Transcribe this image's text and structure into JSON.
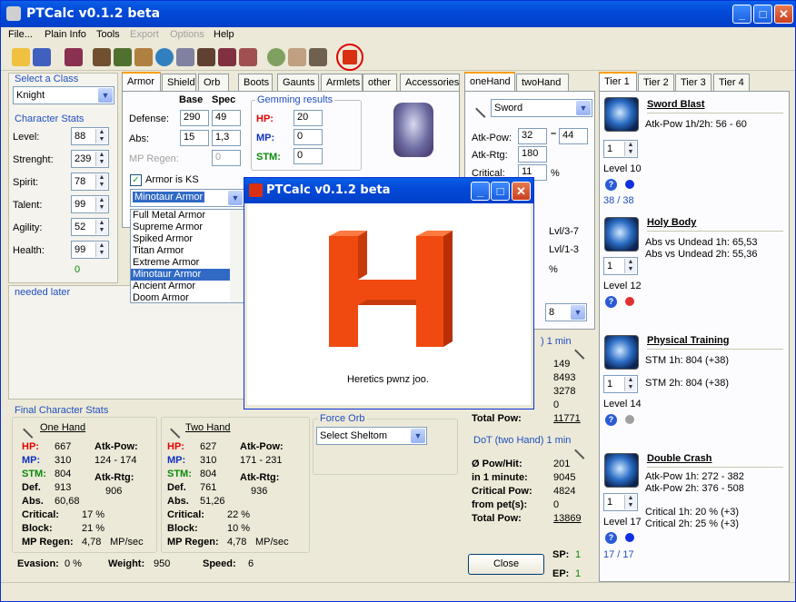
{
  "app": {
    "title": "PTCalc v0.1.2 beta"
  },
  "menu": {
    "file": "File...",
    "plain_info": "Plain Info",
    "tools": "Tools",
    "export": "Export",
    "options": "Options",
    "help": "Help"
  },
  "class_select": {
    "label": "Select a Class",
    "value": "Knight"
  },
  "char_stats": {
    "title": "Character Stats",
    "level_label": "Level:",
    "level": "88",
    "strength_label": "Strenght:",
    "strength": "239",
    "spirit_label": "Spirit:",
    "spirit": "78",
    "talent_label": "Talent:",
    "talent": "99",
    "agility_label": "Agility:",
    "agility": "52",
    "health_label": "Health:",
    "health": "99",
    "remaining": "0"
  },
  "needed_later": "needed later",
  "armor_tabs": [
    "Armor",
    "Shield",
    "Orb",
    "Boots",
    "Gaunts",
    "Armlets",
    "other",
    "Accessories"
  ],
  "armor": {
    "base_header": "Base",
    "spec_header": "Spec",
    "defense_label": "Defense:",
    "defense_base": "290",
    "defense_spec": "49",
    "abs_label": "Abs:",
    "abs_base": "15",
    "abs_spec": "1,3",
    "mpregen_label": "MP Regen:",
    "mpregen_spec": "0",
    "ks_label": "Armor is KS",
    "selected": "Minotaur Armor",
    "list": [
      "Full Metal Armor",
      "Supreme Armor",
      "Spiked Armor",
      "Titan Armor",
      "Extreme Armor",
      "Minotaur Armor",
      "Ancient Armor",
      "Doom Armor"
    ]
  },
  "gemming": {
    "title": "Gemming results",
    "hp_label": "HP:",
    "hp": "20",
    "mp_label": "MP:",
    "mp": "0",
    "stm_label": "STM:",
    "stm": "0"
  },
  "weapon_tabs": [
    "oneHand",
    "twoHand"
  ],
  "weapon": {
    "type": "Sword",
    "atkpow_label": "Atk-Pow:",
    "atkpow_min": "32",
    "atkpow_max": "44",
    "atkrtg_label": "Atk-Rtg:",
    "atkrtg": "180",
    "critical_label": "Critical:",
    "critical": "11",
    "pct": "%",
    "lvl1": "Lvl/3-7",
    "lvl2": "Lvl/1-3",
    "pct2": "%",
    "hits_value": "8"
  },
  "dot_one": {
    "title_suffix": ") 1 min",
    "pow_hit": "149",
    "per_min": "8493",
    "critical_pow": "3278",
    "from_pets": "0",
    "total_label": "Total Pow:",
    "total": "11771"
  },
  "dot_two": {
    "title": "DoT (two Hand) 1 min",
    "pow_hit_label": "Ø Pow/Hit:",
    "pow_hit": "201",
    "per_min_label": "in 1 minute:",
    "per_min": "9045",
    "critical_label": "Critical Pow:",
    "critical_pow": "4824",
    "pets_label": "from pet(s):",
    "from_pets": "0",
    "total_label": "Total Pow:",
    "total": "13869"
  },
  "force_orb": {
    "title": "Force Orb",
    "value": "Select Sheltom"
  },
  "final_stats": {
    "title": "Final Character Stats",
    "one_hand": {
      "title": "One Hand",
      "hp": "667",
      "mp": "310",
      "stm": "804",
      "def": "913",
      "abs": "60,68",
      "critical": "17 %",
      "block": "21 %",
      "mpregen": "4,78",
      "atkpow": "124 - 174",
      "atkrtg": "906"
    },
    "two_hand": {
      "title": "Two Hand",
      "hp": "627",
      "mp": "310",
      "stm": "804",
      "def": "761",
      "abs": "51,26",
      "critical": "22 %",
      "block": "10 %",
      "mpregen": "4,78",
      "atkpow": "171 - 231",
      "atkrtg": "936"
    },
    "labels": {
      "hp": "HP:",
      "mp": "MP:",
      "stm": "STM:",
      "def": "Def.",
      "abs": "Abs.",
      "critical": "Critical:",
      "block": "Block:",
      "mpregen": "MP Regen:",
      "mpsec": "MP/sec",
      "atkpow": "Atk-Pow:",
      "atkrtg": "Atk-Rtg:"
    },
    "evasion_label": "Evasion:",
    "evasion": "0 %",
    "weight_label": "Weight:",
    "weight": "950",
    "speed_label": "Speed:",
    "speed": "6"
  },
  "close_button": "Close",
  "sp_label": "SP:",
  "sp": "1",
  "ep_label": "EP:",
  "ep": "1",
  "tier_tabs": [
    "Tier 1",
    "Tier 2",
    "Tier 3",
    "Tier 4"
  ],
  "skills": [
    {
      "name": "Sword Blast",
      "line1": "Atk-Pow 1h/2h: 56 - 60",
      "line2": "",
      "line3": "",
      "line4": "",
      "points": "1",
      "level": "Level 10",
      "progress": "38 / 38",
      "dot_color": "#1030e0"
    },
    {
      "name": "Holy Body",
      "line1": "Abs vs Undead 1h: 65,53",
      "line2": "Abs vs Undead 2h: 55,36",
      "line3": "",
      "line4": "",
      "points": "1",
      "level": "Level 12",
      "progress": "",
      "dot_color": "#e03030"
    },
    {
      "name": "Physical Training",
      "line1": "STM 1h: 804 (+38)",
      "line2": "",
      "line3": "STM 2h: 804 (+38)",
      "line4": "",
      "points": "1",
      "level": "Level 14",
      "progress": "",
      "dot_color": "#a0a0a0"
    },
    {
      "name": "Double Crash",
      "line1": "Atk-Pow 1h: 272 - 382",
      "line2": "Atk-Pow 2h: 376 - 508",
      "line3": "Critical 1h: 20 % (+3)",
      "line4": "Critical 2h: 25 % (+3)",
      "points": "1",
      "level": "Level 17",
      "progress": "17 / 17",
      "dot_color": "#1030e0"
    }
  ],
  "popup": {
    "title": "PTCalc v0.1.2 beta",
    "message": "Heretics pwnz joo."
  }
}
